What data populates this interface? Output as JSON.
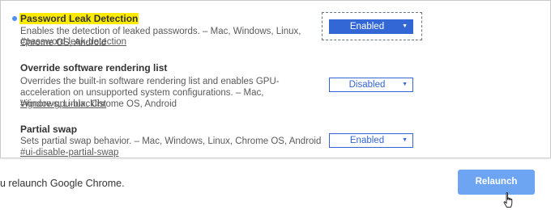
{
  "flags": [
    {
      "title": "Password Leak Detection",
      "description": "Enables the detection of leaked passwords. – Mac, Windows, Linux, Chrome OS, Android",
      "anchor": "#password-leak-detection",
      "value": "Enabled",
      "modified": true,
      "highlighted": true
    },
    {
      "title": "Override software rendering list",
      "description": "Overrides the built-in software rendering list and enables GPU-acceleration on unsupported system configurations. – Mac, Windows, Linux, Chrome OS, Android",
      "anchor": "#ignore-gpu-blacklist",
      "value": "Disabled"
    },
    {
      "title": "Partial swap",
      "description": "Sets partial swap behavior. – Mac, Windows, Linux, Chrome OS, Android",
      "anchor": "#ui-disable-partial-swap",
      "value": "Enabled"
    }
  ],
  "footer": {
    "message": "u relaunch Google Chrome.",
    "relaunch_label": "Relaunch"
  },
  "colors": {
    "accent": "#3367d6",
    "relaunch_bg": "#6ea5f2",
    "highlight": "#ffeb00",
    "modified_dot": "#4f8ff2"
  },
  "icons": {
    "dropdown": "chevron-down-icon",
    "modified": "modified-dot-icon",
    "cursor": "hand-pointer-icon"
  }
}
